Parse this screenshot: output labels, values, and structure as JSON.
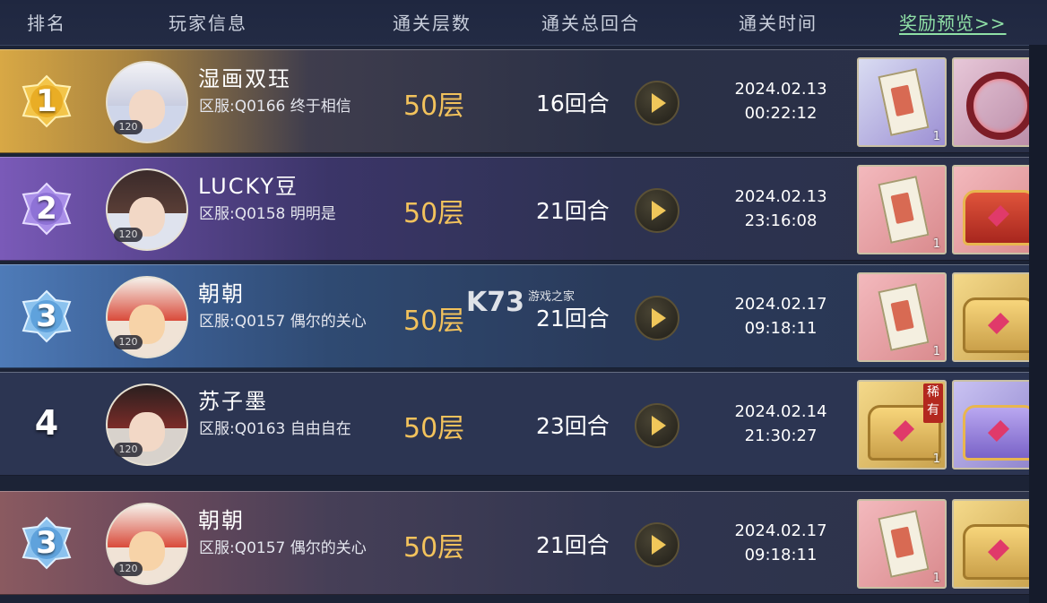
{
  "header": {
    "rank": "排名",
    "player_info": "玩家信息",
    "floors": "通关层数",
    "rounds": "通关总回合",
    "time": "通关时间",
    "reward_preview": "奖励预览>>"
  },
  "rows": [
    {
      "rank": "1",
      "name": "湿画双珏",
      "server": "区服:Q0166 终于相信",
      "level": "120",
      "floors": "50层",
      "rounds": "16回合",
      "date": "2024.02.13",
      "clock": "00:22:12",
      "reward1_qty": "1"
    },
    {
      "rank": "2",
      "name": "LUCKY豆",
      "server": "区服:Q0158 明明是",
      "level": "120",
      "floors": "50层",
      "rounds": "21回合",
      "date": "2024.02.13",
      "clock": "23:16:08",
      "reward1_qty": "1"
    },
    {
      "rank": "3",
      "name": "朝朝",
      "server": "区服:Q0157 偶尔的关心",
      "level": "120",
      "floors": "50层",
      "rounds": "21回合",
      "date": "2024.02.17",
      "clock": "09:18:11",
      "reward1_qty": "1"
    },
    {
      "rank": "4",
      "name": "苏子墨",
      "server": "区服:Q0163 自由自在",
      "level": "120",
      "floors": "50层",
      "rounds": "23回合",
      "date": "2024.02.14",
      "clock": "21:30:27",
      "reward1_qty": "1",
      "rare_tag": "稀有"
    },
    {
      "rank": "3",
      "name": "朝朝",
      "server": "区服:Q0157 偶尔的关心",
      "level": "120",
      "floors": "50层",
      "rounds": "21回合",
      "date": "2024.02.17",
      "clock": "09:18:11",
      "reward1_qty": "1"
    }
  ],
  "watermark": {
    "text": "K73",
    "sub": "游戏之家"
  },
  "colors": {
    "floors": "#f2c25c",
    "link": "#8fe0a6",
    "play_icon": "#f0c75a"
  },
  "icons": {
    "play": "play-icon",
    "rank_badge": "lotus-badge-icon"
  }
}
